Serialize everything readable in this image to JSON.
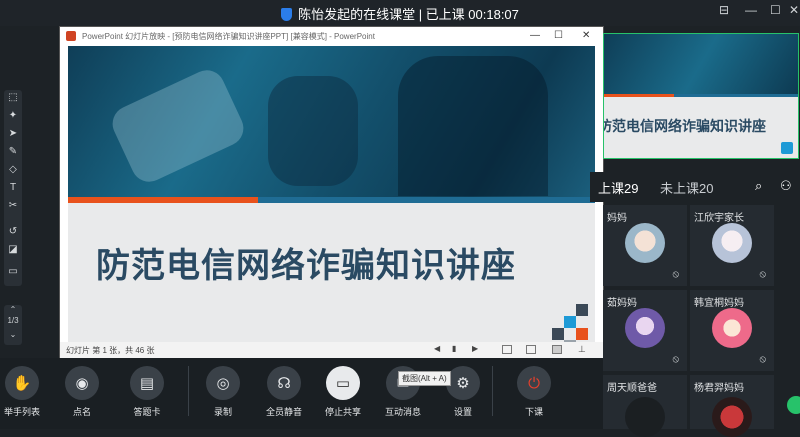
{
  "titlebar": {
    "title": "陈怡发起的在线课堂 | 已上课 00:18:07",
    "icon": "shield-icon"
  },
  "left_toolbar": {
    "page_indicator": "1/3"
  },
  "ppt_window": {
    "title": "PowerPoint 幻灯片放映 - [预防电信网络诈骗知识讲座PPT] [兼容模式] - PowerPoint",
    "status": "幻灯片 第 1 张，共 46 张"
  },
  "slide": {
    "headline": "防范电信网络诈骗知识讲座"
  },
  "thumbnail": {
    "headline": "防范电信网络诈骗知识讲座"
  },
  "tabs": {
    "attended": "上课29",
    "absent": "未上课20"
  },
  "students": [
    {
      "name": "妈妈"
    },
    {
      "name": "江欣宇家长"
    },
    {
      "name": "茹妈妈"
    },
    {
      "name": "韩宜桐妈妈"
    },
    {
      "name": "周天顺爸爸"
    },
    {
      "name": "杨君羿妈妈"
    }
  ],
  "bottom_bar": {
    "items": [
      {
        "label": "举手列表"
      },
      {
        "label": "点名"
      },
      {
        "label": "答题卡"
      },
      {
        "label": "录制"
      },
      {
        "label": "全员静音"
      },
      {
        "label": "停止共享"
      },
      {
        "label": "互动消息"
      },
      {
        "label": "设置"
      },
      {
        "label": "下课"
      }
    ],
    "tooltip": "截图(Alt + A)"
  },
  "colors": {
    "accent_green": "#27c26a",
    "end_class_red": "#e8402c",
    "slide_orange": "#e8521c",
    "slide_blue": "#1f6c94"
  }
}
